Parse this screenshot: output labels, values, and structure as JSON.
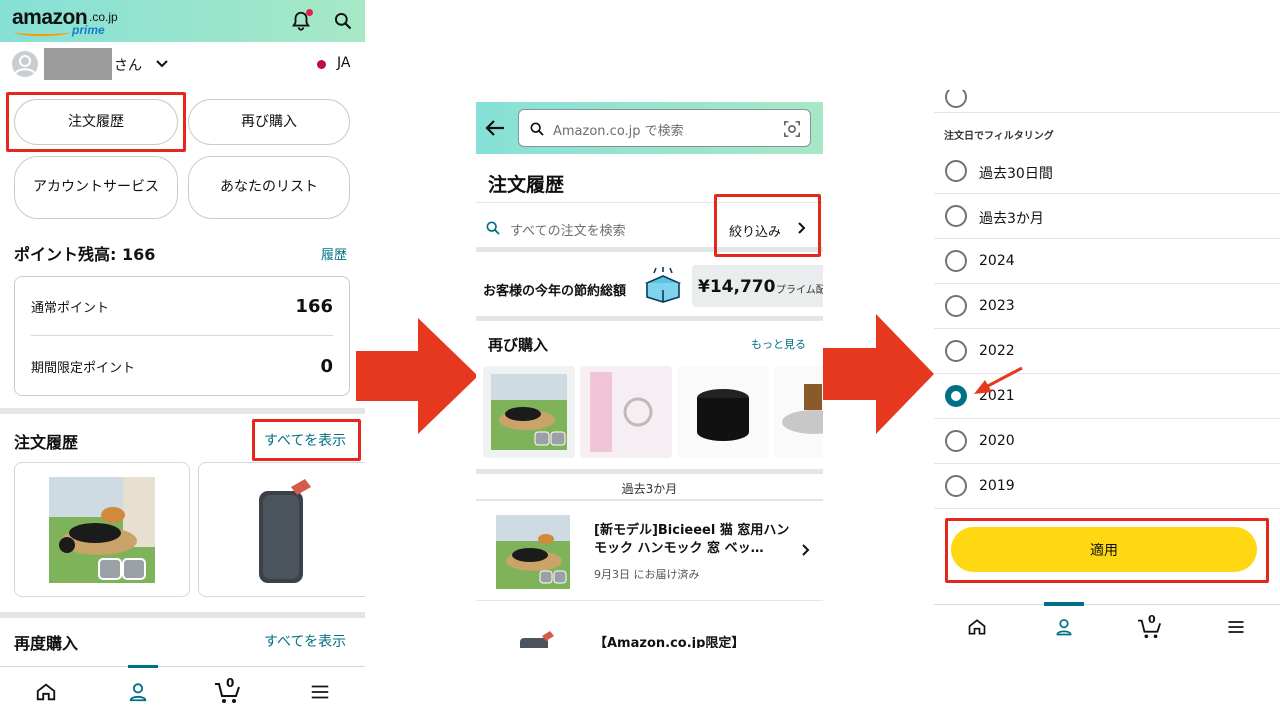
{
  "panel1": {
    "logo": {
      "brand": "amazon",
      "domain": ".co.jp",
      "tier": "prime"
    },
    "user": {
      "suffix": "さん",
      "lang": "JA"
    },
    "buttons": [
      "注文履歴",
      "再び購入",
      "アカウントサービス",
      "あなたのリスト"
    ],
    "points": {
      "title": "ポイント残高: 166",
      "history_link": "履歴",
      "rows": [
        {
          "label": "通常ポイント",
          "value": "166"
        },
        {
          "label": "期間限定ポイント",
          "value": "0"
        }
      ]
    },
    "orders": {
      "title": "注文履歴",
      "view_all": "すべてを表示"
    },
    "rebuy": {
      "title": "再度購入",
      "view_all": "すべてを表示"
    },
    "nav": {
      "cart_count": "0"
    }
  },
  "panel2": {
    "search_placeholder": "Amazon.co.jp で検索",
    "title": "注文履歴",
    "order_search_placeholder": "すべての注文を検索",
    "filter_label": "絞り込み",
    "savings": {
      "label": "お客様の今年の節約総額",
      "amount": "¥14,770",
      "note": "プライム配"
    },
    "rebuy": {
      "title": "再び購入",
      "more": "もっと見る"
    },
    "period_label": "過去3か月",
    "order1": {
      "title": "[新モデル]Bicieeel 猫 窓用ハンモック ハンモック 窓 ベッ…",
      "status": "9月3日 にお届け済み"
    },
    "order2": {
      "title": "【Amazon.co.jp限定】"
    }
  },
  "panel3": {
    "filter_section": "注文日でフィルタリング",
    "options": [
      "過去30日間",
      "過去3か月",
      "2024",
      "2023",
      "2022",
      "2021",
      "2020",
      "2019"
    ],
    "selected": "2021",
    "apply": "適用",
    "nav": {
      "cart_count": "0"
    }
  },
  "colors": {
    "highlight": "#e5281e",
    "accent": "#007185",
    "apply_button": "#ffd814",
    "header": "#94e3d0"
  }
}
